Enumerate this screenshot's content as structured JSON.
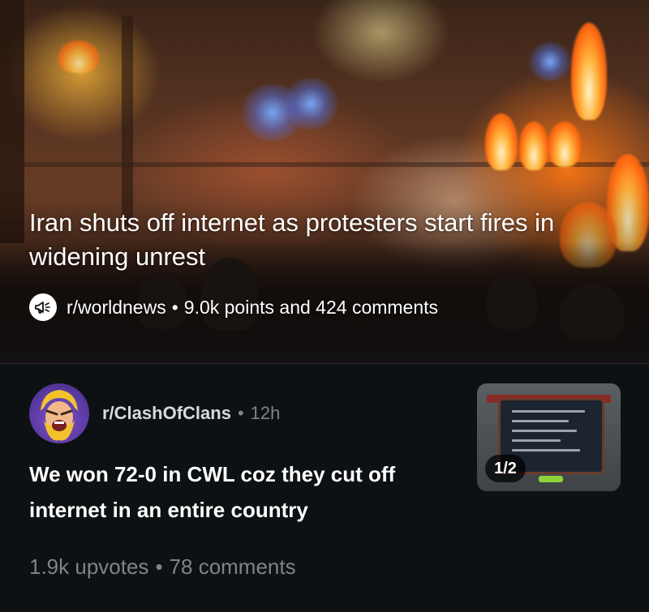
{
  "hero": {
    "title": "Iran shuts off internet as protesters start fires in widening unrest",
    "subreddit": "r/worldnews",
    "separator": "•",
    "stats": "9.0k points and 424 comments",
    "icon": "megaphone-icon"
  },
  "post": {
    "subreddit": "r/ClashOfClans",
    "separator": "•",
    "time": "12h",
    "title": "We won 72-0 in CWL coz they cut off internet in an entire country",
    "gallery_badge": "1/2",
    "upvotes": "1.9k upvotes",
    "comments": "78 comments",
    "avatar_icon": "barbarian-avatar",
    "colors": {
      "title": "#ffffff",
      "muted": "#818384",
      "background": "#0e1113"
    }
  }
}
